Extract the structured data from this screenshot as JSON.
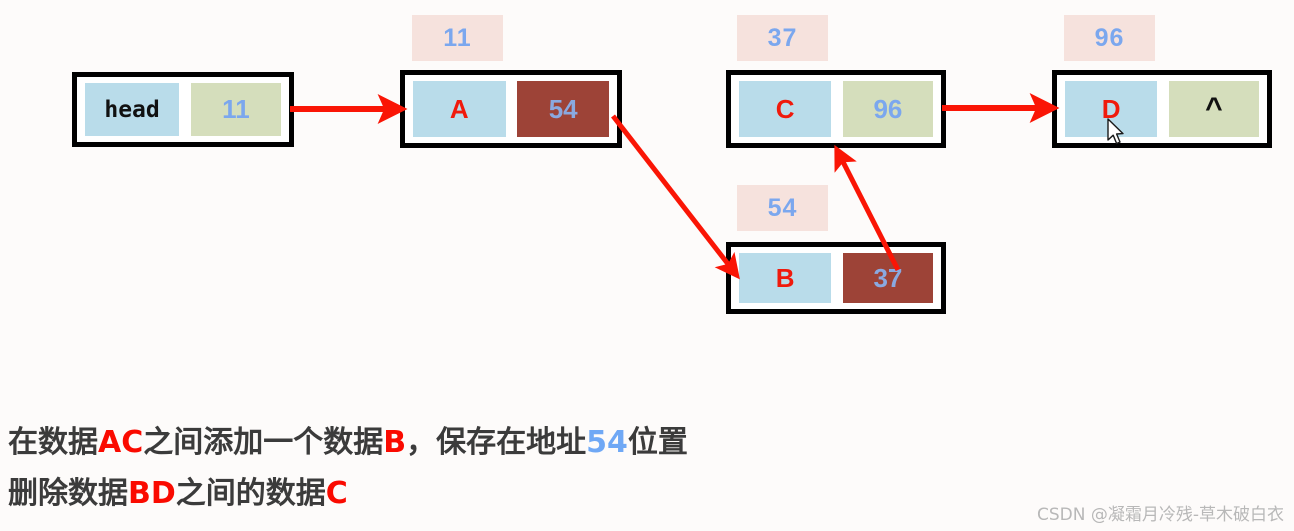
{
  "diagram": {
    "title": "linked-list insertion and deletion diagram",
    "colors": {
      "background": "#fdfbfa",
      "node_border": "#000000",
      "data_cell_bg": "#b9dcea",
      "data_cell_text": "#f01a0c",
      "next_cell_bg": "#d5debc",
      "next_cell_text": "#7ba7ee",
      "next_cell_highlight_bg": "#9d4337",
      "address_tag_bg": "#f6e2dd",
      "address_tag_text": "#7ba7ee",
      "arrow": "#fa1505",
      "caption_text": "#3b3b3b",
      "caption_red": "#fa0a00",
      "caption_blue": "#6fa8f5"
    },
    "nodes": [
      {
        "id": "head",
        "address_label": "",
        "data": "head",
        "next": "11",
        "next_highlighted": false
      },
      {
        "id": "A",
        "address_label": "11",
        "data": "A",
        "next": "54",
        "next_highlighted": true
      },
      {
        "id": "C",
        "address_label": "37",
        "data": "C",
        "next": "96",
        "next_highlighted": false
      },
      {
        "id": "D",
        "address_label": "96",
        "data": "D",
        "next": "^",
        "next_highlighted": false
      },
      {
        "id": "B",
        "address_label": "54",
        "data": "B",
        "next": "37",
        "next_highlighted": true
      }
    ]
  },
  "caption": {
    "line1": {
      "seg1": "在数据",
      "seg2_red": "AC",
      "seg3": "之间添加一个数据",
      "seg4_red": "B",
      "seg5": "，保存在地址",
      "seg6_blue": "54",
      "seg7": "位置"
    },
    "line2": {
      "seg1": "删除数据",
      "seg2_red": "BD",
      "seg3": "之间的数据",
      "seg4_red": "C"
    }
  },
  "watermark": {
    "text": "CSDN @凝霜月冷残-草木破白衣"
  }
}
